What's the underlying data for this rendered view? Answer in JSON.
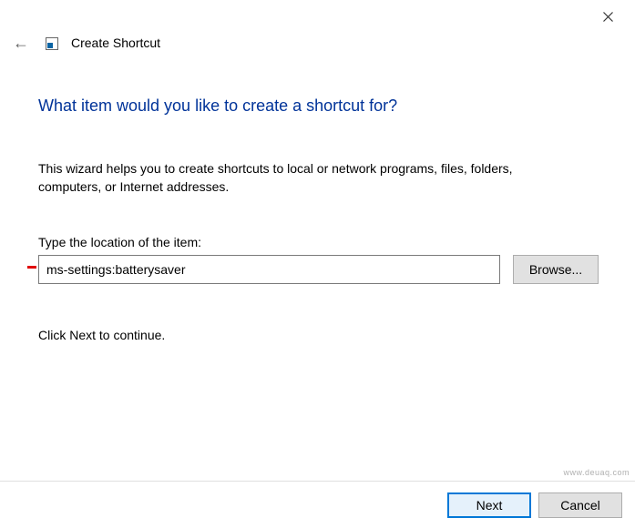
{
  "window": {
    "title": "Create Shortcut"
  },
  "page": {
    "heading": "What item would you like to create a shortcut for?",
    "description": "This wizard helps you to create shortcuts to local or network programs, files, folders, computers, or Internet addresses.",
    "field_label": "Type the location of the item:",
    "location_value": "ms-settings:batterysaver",
    "browse_label": "Browse...",
    "continue_text": "Click Next to continue."
  },
  "footer": {
    "next_label": "Next",
    "cancel_label": "Cancel"
  },
  "watermark": "www.deuaq.com"
}
